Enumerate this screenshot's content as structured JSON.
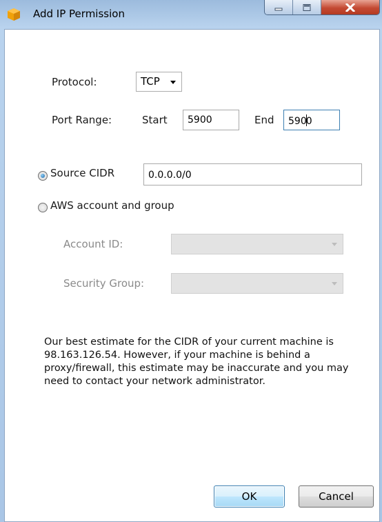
{
  "window": {
    "title": "Add IP Permission",
    "icon": "orange-cube-icon",
    "controls": [
      "minimize-icon",
      "maximize-icon",
      "close-icon"
    ]
  },
  "form": {
    "protocol_label": "Protocol:",
    "protocol_value": "TCP",
    "port_range_label": "Port Range:",
    "start_label": "Start",
    "start_value": "5900",
    "end_label": "End",
    "end_value_before_caret": "590",
    "end_value_after_caret": "0",
    "source_cidr_label": "Source CIDR",
    "source_cidr_value": "0.0.0.0/0",
    "source_cidr_selected": true,
    "aws_option_label": "AWS account and group",
    "account_id_label": "Account ID:",
    "account_id_value": "",
    "security_group_label": "Security Group:",
    "security_group_value": ""
  },
  "info_text": "Our best estimate for the CIDR of your current machine is 98.163.126.54. However, if your machine is behind a proxy/firewall, this estimate may be inaccurate and you may need to contact your network administrator.",
  "buttons": {
    "ok": "OK",
    "cancel": "Cancel"
  },
  "colors": {
    "accent": "#3c7fb1",
    "titlebar": "#b9d3ee",
    "close": "#c44a33"
  }
}
